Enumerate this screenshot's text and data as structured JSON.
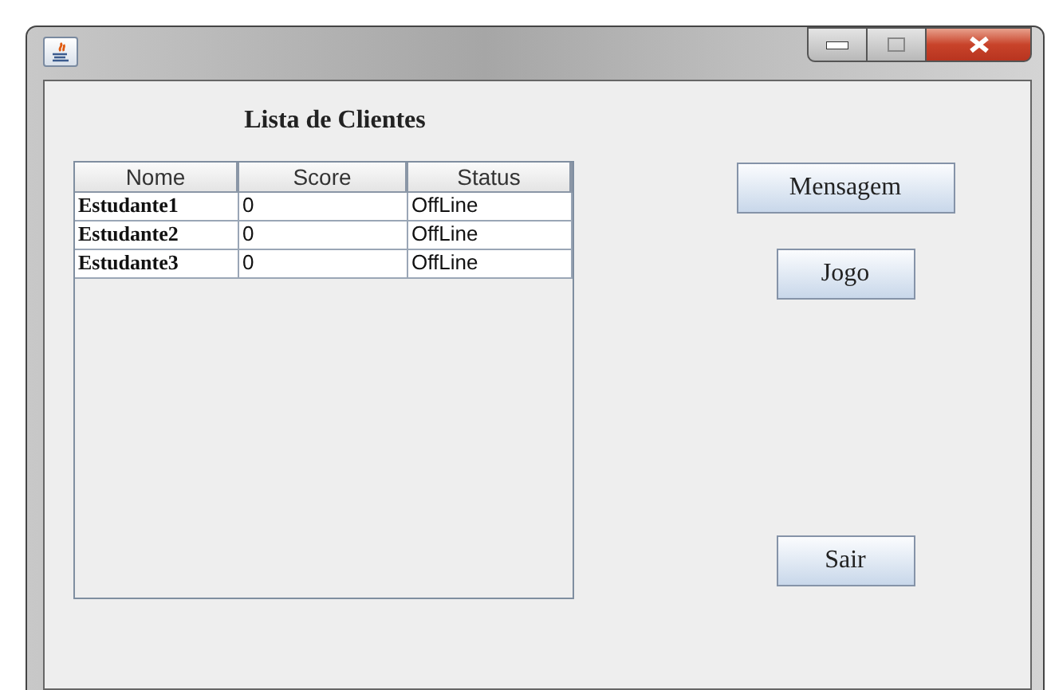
{
  "title": "Lista de Clientes",
  "table": {
    "columns": [
      "Nome",
      "Score",
      "Status"
    ],
    "rows": [
      [
        "Estudante1",
        "0",
        "OffLine"
      ],
      [
        "Estudante2",
        "0",
        "OffLine"
      ],
      [
        "Estudante3",
        "0",
        "OffLine"
      ]
    ]
  },
  "buttons": [
    {
      "label": "Mensagem",
      "kind": "wide"
    },
    {
      "label": "Jogo",
      "kind": "narrow"
    }
  ],
  "exit_button": {
    "label": "Sair"
  }
}
